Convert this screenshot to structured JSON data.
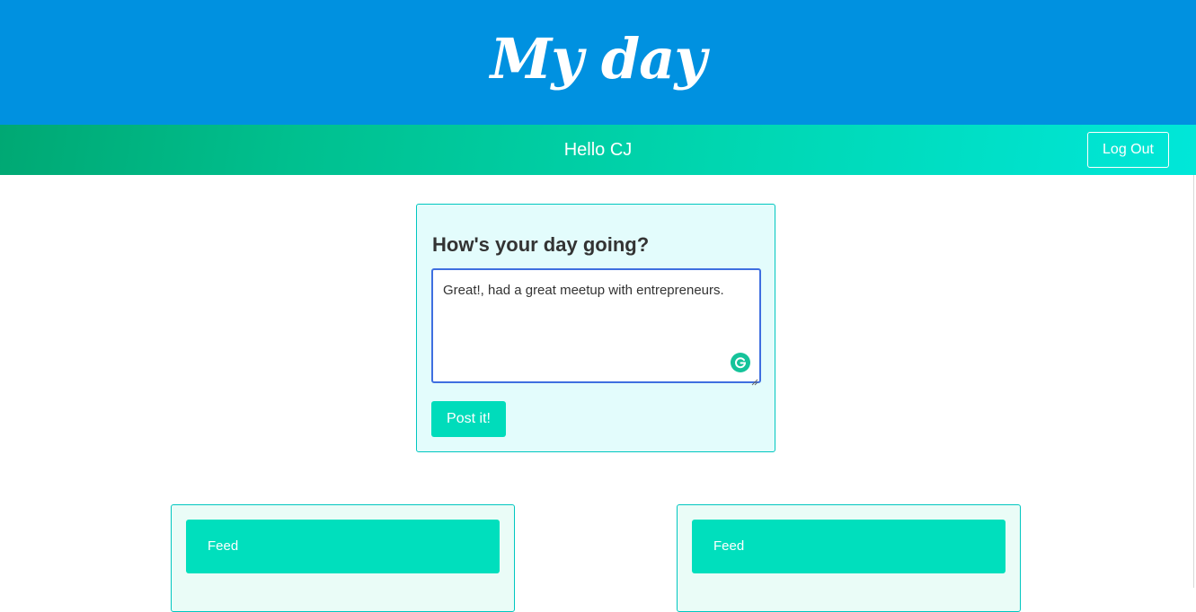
{
  "header": {
    "title": "My day"
  },
  "greeting_bar": {
    "greeting": "Hello CJ",
    "logout_label": "Log Out"
  },
  "post_form": {
    "heading": "How's your day going?",
    "textarea_value": "Great!, had a great meetup with entrepreneurs.",
    "submit_label": "Post it!",
    "grammar_icon": "grammarly-g-icon"
  },
  "feeds": [
    {
      "header": "Feed"
    },
    {
      "header": "Feed"
    }
  ],
  "colors": {
    "header_bg": "#0091e0",
    "greeting_gradient_start": "#00a873",
    "greeting_gradient_end": "#00e7d9",
    "accent": "#00dcbb",
    "card_border": "#00c7c0"
  }
}
